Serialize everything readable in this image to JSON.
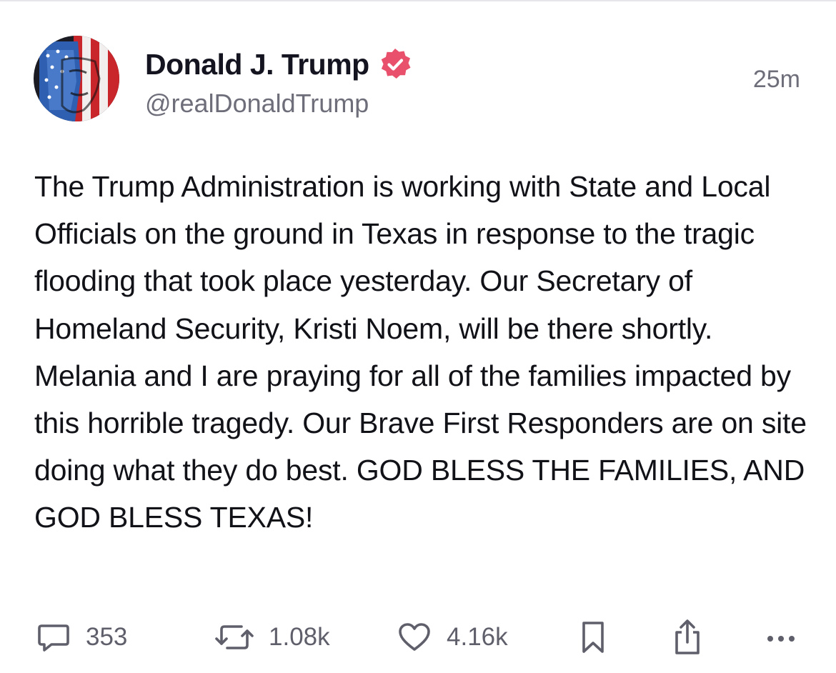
{
  "post": {
    "author": {
      "display_name": "Donald J. Trump",
      "handle": "@realDonaldTrump",
      "verified": true,
      "avatar": "avatar-portrait-flag"
    },
    "timestamp": "25m",
    "body": "The Trump Administration is working with State and Local Officials on the ground in Texas in response to the tragic flooding that took place yesterday. Our Secretary of Homeland Security, Kristi Noem, will be there shortly. Melania and I are praying for all of the families impacted by this horrible tragedy. Our Brave First Responders are on site doing what they do best. GOD BLESS THE FAMILIES, AND GOD BLESS TEXAS!",
    "actions": {
      "replies": "353",
      "reposts": "1.08k",
      "likes": "4.16k"
    }
  },
  "icons": {
    "reply": "speech-bubble-icon",
    "repost": "repost-arrows-icon",
    "like": "heart-icon",
    "bookmark": "bookmark-icon",
    "share": "share-upload-icon",
    "more": "more-dots-icon",
    "verified": "verified-badge-icon"
  },
  "colors": {
    "verified_badge": "#e8506b",
    "text_primary": "#111118",
    "text_secondary": "#6e6e7a",
    "icon_gray": "#5f5f6b"
  }
}
